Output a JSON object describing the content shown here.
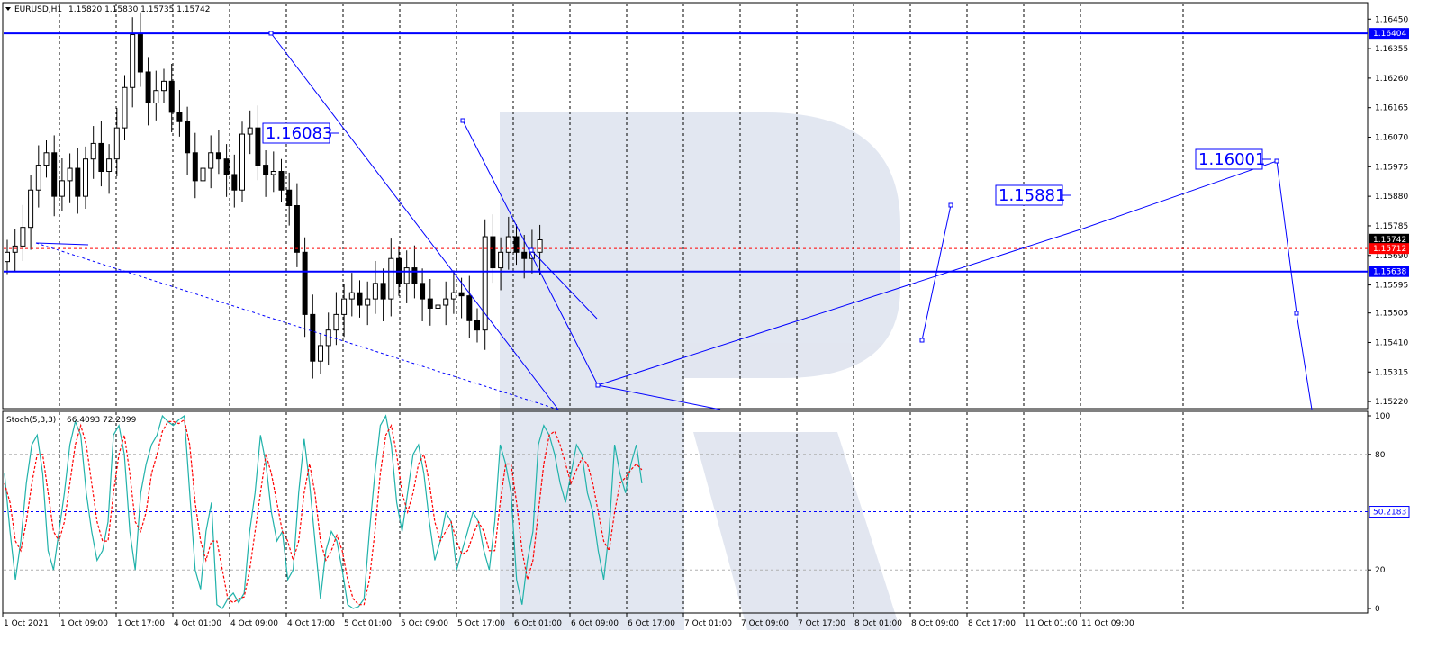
{
  "header": {
    "symbol_text": "EURUSD,H1",
    "ohlc_text": "1.15820 1.15830 1.15735 1.15742"
  },
  "stoch_header": {
    "name_text": "Stoch(5,3,3)",
    "values_text": "66.4093 72.2899"
  },
  "colors": {
    "bull_body": "#ffffff",
    "bear_body": "#000000",
    "candle_outline": "#000000",
    "level_line": "#0000ff",
    "bid_line": "#ff0000",
    "stoch_main": "#20b2aa",
    "stoch_signal": "#ff0000",
    "grid": "#000000",
    "watermark": "#d6dcea"
  },
  "chart_data": [
    {
      "type": "candlestick",
      "symbol": "EURUSD",
      "timeframe": "H1",
      "x_labels": [
        "1 Oct 2021",
        "1 Oct 09:00",
        "1 Oct 17:00",
        "4 Oct 01:00",
        "4 Oct 09:00",
        "4 Oct 17:00",
        "5 Oct 01:00",
        "5 Oct 09:00",
        "5 Oct 17:00",
        "6 Oct 01:00",
        "6 Oct 09:00",
        "6 Oct 17:00",
        "7 Oct 01:00",
        "7 Oct 09:00",
        "7 Oct 17:00",
        "8 Oct 01:00",
        "8 Oct 09:00",
        "8 Oct 17:00",
        "11 Oct 01:00",
        "11 Oct 09:00"
      ],
      "ylim": [
        1.152,
        1.165
      ],
      "y_ticks": [
        "1.16450",
        "1.16355",
        "1.16260",
        "1.16165",
        "1.16070",
        "1.15975",
        "1.15880",
        "1.15785",
        "1.15690",
        "1.15595",
        "1.15505",
        "1.15410",
        "1.15315",
        "1.15220"
      ],
      "close_path": [
        1.157,
        1.1572,
        1.1578,
        1.159,
        1.1598,
        1.1602,
        1.1588,
        1.1593,
        1.1597,
        1.1588,
        1.16,
        1.1605,
        1.1596,
        1.16,
        1.161,
        1.1623,
        1.164,
        1.1628,
        1.1618,
        1.1622,
        1.1625,
        1.1615,
        1.1612,
        1.1602,
        1.1593,
        1.1597,
        1.1602,
        1.16,
        1.1595,
        1.159,
        1.1608,
        1.161,
        1.1598,
        1.1595,
        1.1596,
        1.159,
        1.1585,
        1.157,
        1.155,
        1.1535,
        1.154,
        1.1545,
        1.155,
        1.1555,
        1.1557,
        1.1553,
        1.1555,
        1.156,
        1.1555,
        1.1568,
        1.156,
        1.1565,
        1.156,
        1.1555,
        1.1552,
        1.1553,
        1.1555,
        1.1557,
        1.1556,
        1.1548,
        1.1545,
        1.1575,
        1.1565,
        1.157,
        1.1575,
        1.157,
        1.1568,
        1.157,
        1.1574
      ],
      "annotations": [
        {
          "label": "1.16083",
          "text_value": 1.16083
        },
        {
          "label": "1.16001",
          "text_value": 1.16001
        },
        {
          "label": "1.15881",
          "text_value": 1.15881
        }
      ],
      "price_labels": [
        {
          "label": "1.16404",
          "value": 1.16404,
          "kind": "level"
        },
        {
          "label": "1.15742",
          "value": 1.15742,
          "kind": "current"
        },
        {
          "label": "1.15712",
          "value": 1.15712,
          "kind": "bid"
        },
        {
          "label": "1.15638",
          "value": 1.15638,
          "kind": "level"
        }
      ],
      "grid": true
    },
    {
      "type": "line",
      "title": "Stoch(5,3,3)",
      "ylim": [
        0,
        100
      ],
      "y_ticks": [
        "100",
        "80",
        "20",
        "0"
      ],
      "levels": [
        80,
        20
      ],
      "current_level": {
        "label": "50.2183",
        "value": 50.2183
      },
      "series": [
        {
          "name": "main",
          "values": [
            70,
            40,
            15,
            35,
            65,
            85,
            90,
            70,
            30,
            20,
            40,
            60,
            85,
            97,
            90,
            60,
            40,
            25,
            30,
            45,
            90,
            95,
            80,
            40,
            20,
            60,
            75,
            85,
            90,
            100,
            97,
            95,
            98,
            100,
            60,
            20,
            10,
            40,
            55,
            2,
            0,
            5,
            8,
            3,
            8,
            40,
            60,
            90,
            75,
            50,
            35,
            40,
            15,
            20,
            60,
            88,
            65,
            35,
            5,
            30,
            40,
            35,
            20,
            2,
            0,
            1,
            5,
            40,
            70,
            95,
            100,
            85,
            55,
            40,
            60,
            80,
            85,
            70,
            45,
            25,
            35,
            50,
            45,
            20,
            30,
            40,
            50,
            45,
            30,
            20,
            45,
            85,
            75,
            60,
            15,
            2,
            25,
            40,
            85,
            95,
            90,
            80,
            65,
            55,
            70,
            85,
            80,
            60,
            50,
            30,
            15,
            40,
            85,
            70,
            60,
            75,
            85,
            65
          ]
        },
        {
          "name": "signal",
          "values": [
            65,
            55,
            35,
            30,
            45,
            65,
            80,
            80,
            60,
            40,
            35,
            45,
            65,
            85,
            95,
            85,
            65,
            45,
            35,
            35,
            60,
            80,
            90,
            70,
            45,
            40,
            50,
            70,
            80,
            92,
            97,
            97,
            96,
            98,
            85,
            55,
            35,
            25,
            35,
            35,
            20,
            5,
            3,
            5,
            6,
            20,
            40,
            60,
            80,
            70,
            55,
            40,
            35,
            25,
            35,
            60,
            75,
            60,
            35,
            25,
            30,
            38,
            30,
            15,
            5,
            2,
            2,
            15,
            40,
            70,
            90,
            95,
            80,
            60,
            50,
            60,
            75,
            80,
            65,
            45,
            35,
            40,
            45,
            35,
            28,
            30,
            38,
            45,
            40,
            30,
            30,
            55,
            75,
            75,
            55,
            30,
            15,
            25,
            50,
            75,
            90,
            92,
            85,
            75,
            65,
            72,
            78,
            75,
            65,
            50,
            35,
            30,
            50,
            65,
            68,
            72,
            75,
            72
          ]
        }
      ]
    }
  ]
}
